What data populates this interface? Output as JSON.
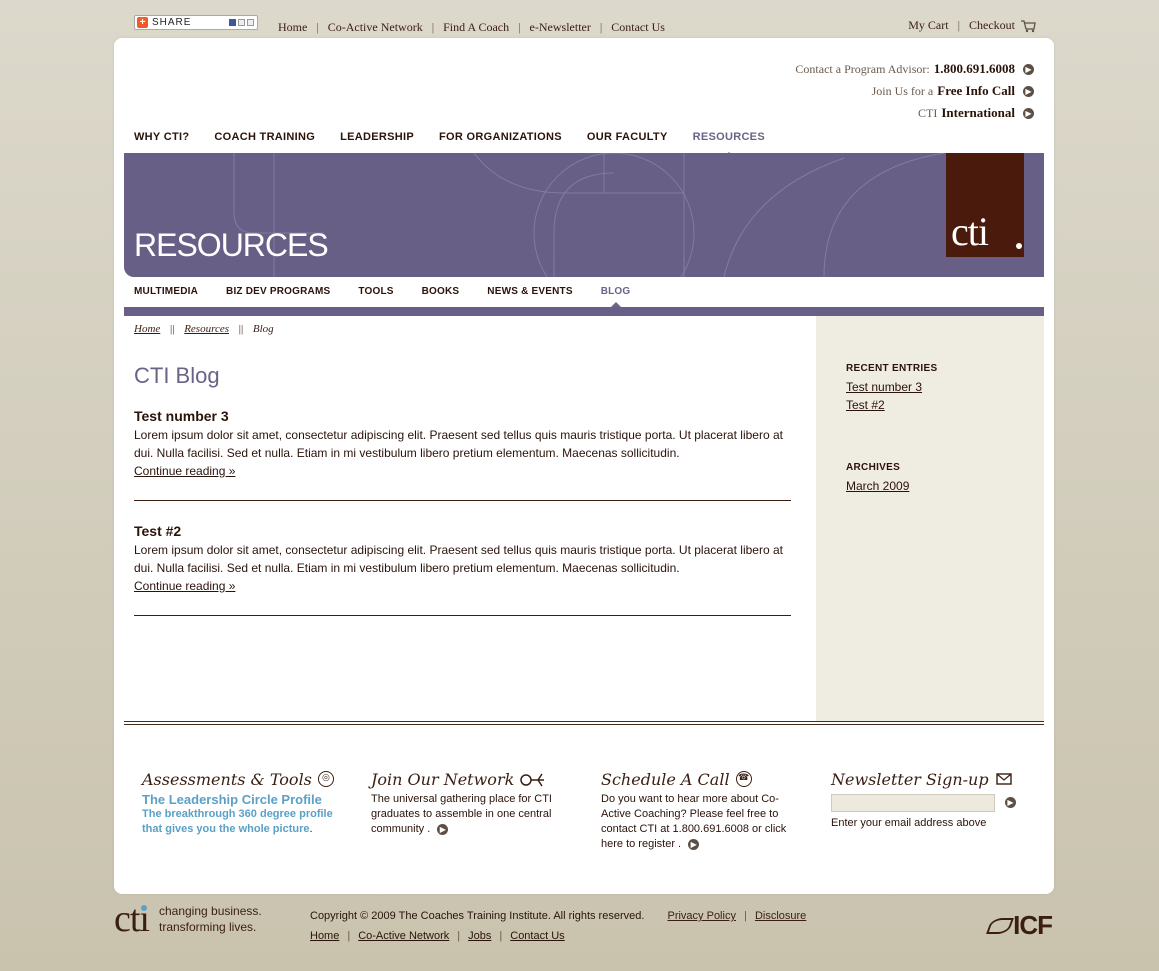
{
  "share": {
    "label": "SHARE"
  },
  "topnav": [
    "Home",
    "Co-Active Network",
    "Find A Coach",
    "e-Newsletter",
    "Contact Us"
  ],
  "cart": {
    "my_cart": "My Cart",
    "checkout": "Checkout"
  },
  "contact": {
    "advisor_prefix": "Contact a Program Advisor:",
    "advisor_phone": "1.800.691.6008",
    "infocall_prefix": "Join Us for a",
    "infocall_bold": "Free Info Call",
    "intl_prefix": "CTI",
    "intl_bold": "International"
  },
  "mainnav": [
    "WHY CTI?",
    "COACH TRAINING",
    "LEADERSHIP",
    "FOR ORGANIZATIONS",
    "OUR FACULTY",
    "RESOURCES"
  ],
  "mainnav_active": "RESOURCES",
  "banner": {
    "title": "RESOURCES",
    "logo": "cti"
  },
  "subnav": [
    "MULTIMEDIA",
    "BIZ DEV PROGRAMS",
    "TOOLS",
    "BOOKS",
    "NEWS & EVENTS",
    "BLOG"
  ],
  "subnav_active": "BLOG",
  "breadcrumb": [
    "Home",
    "Resources",
    "Blog"
  ],
  "breadcrumb_sep": "||",
  "page_title": "CTI Blog",
  "posts": [
    {
      "title": "Test number 3",
      "body": "Lorem ipsum dolor sit amet, consectetur adipiscing elit. Praesent sed tellus quis mauris tristique porta. Ut placerat libero at dui. Nulla facilisi. Sed et nulla. Etiam in mi vestibulum libero pretium elementum. Maecenas sollicitudin.",
      "more": "Continue reading »"
    },
    {
      "title": "Test #2",
      "body": "Lorem ipsum dolor sit amet, consectetur adipiscing elit. Praesent sed tellus quis mauris tristique porta. Ut placerat libero at dui. Nulla facilisi. Sed et nulla. Etiam in mi vestibulum libero pretium elementum. Maecenas sollicitudin.",
      "more": "Continue reading »"
    }
  ],
  "sidebar": {
    "recent_title": "RECENT ENTRIES",
    "recent": [
      "Test number 3",
      "Test #2"
    ],
    "archives_title": "ARCHIVES",
    "archives": [
      "March 2009"
    ]
  },
  "promos": {
    "assessments": {
      "heading": "Assessments & Tools",
      "link_title": "The Leadership Circle Profile",
      "link_body": "The breakthrough 360 degree profile that gives you the whole picture",
      "trail": "."
    },
    "network": {
      "heading": "Join Our Network",
      "body": "The universal gathering place for CTI graduates to assemble in one central community ."
    },
    "call": {
      "heading": "Schedule A Call",
      "body": "Do you want to hear more about Co-Active Coaching? Please feel free to contact CTI at 1.800.691.6008 or click here to register ."
    },
    "newsletter": {
      "heading": "Newsletter Sign-up",
      "input_value": "",
      "hint": "Enter your email address above"
    }
  },
  "footer": {
    "logo": "cti",
    "tagline_1": "changing business.",
    "tagline_2": "transforming lives.",
    "copyright": "Copyright © 2009 The Coaches Training Institute. All rights reserved.",
    "privacy": "Privacy Policy",
    "disclosure": "Disclosure",
    "links": [
      "Home",
      "Co-Active Network",
      "Jobs",
      "Contact Us"
    ],
    "icf": "ICF"
  },
  "colors": {
    "brand_purple": "#675f85",
    "brand_brown": "#4a1a0c",
    "link_blue": "#5aa0c7",
    "sidebar_bg": "#efece2"
  }
}
